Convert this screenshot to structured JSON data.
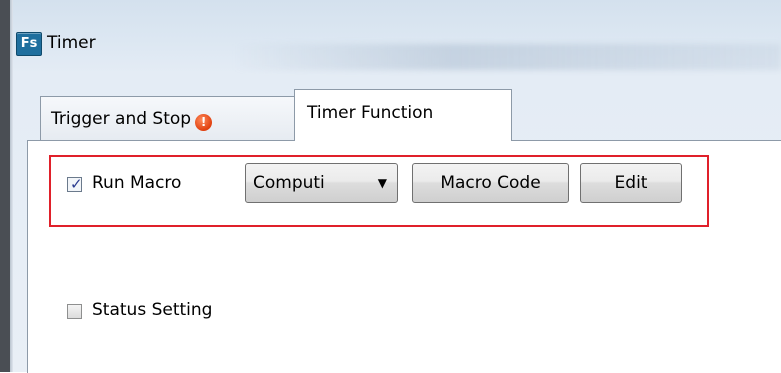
{
  "window": {
    "icon_text": "Fs",
    "title": "Timer"
  },
  "tabs": [
    {
      "label": "Trigger and Stop",
      "active": false,
      "badge_icon": "alert-icon"
    },
    {
      "label": "Timer Function",
      "active": true
    }
  ],
  "timer_function": {
    "run_macro": {
      "checked": true,
      "label": "Run Macro"
    },
    "macro_select": {
      "selected": "Computi"
    },
    "macro_code_label": "Macro Code",
    "edit_label": "Edit",
    "status_setting": {
      "checked": false,
      "label": "Status Setting"
    }
  },
  "colors": {
    "highlight": "#e0202a",
    "checkmark": "#2a3b8f",
    "app_icon": "#1f6f9e"
  }
}
